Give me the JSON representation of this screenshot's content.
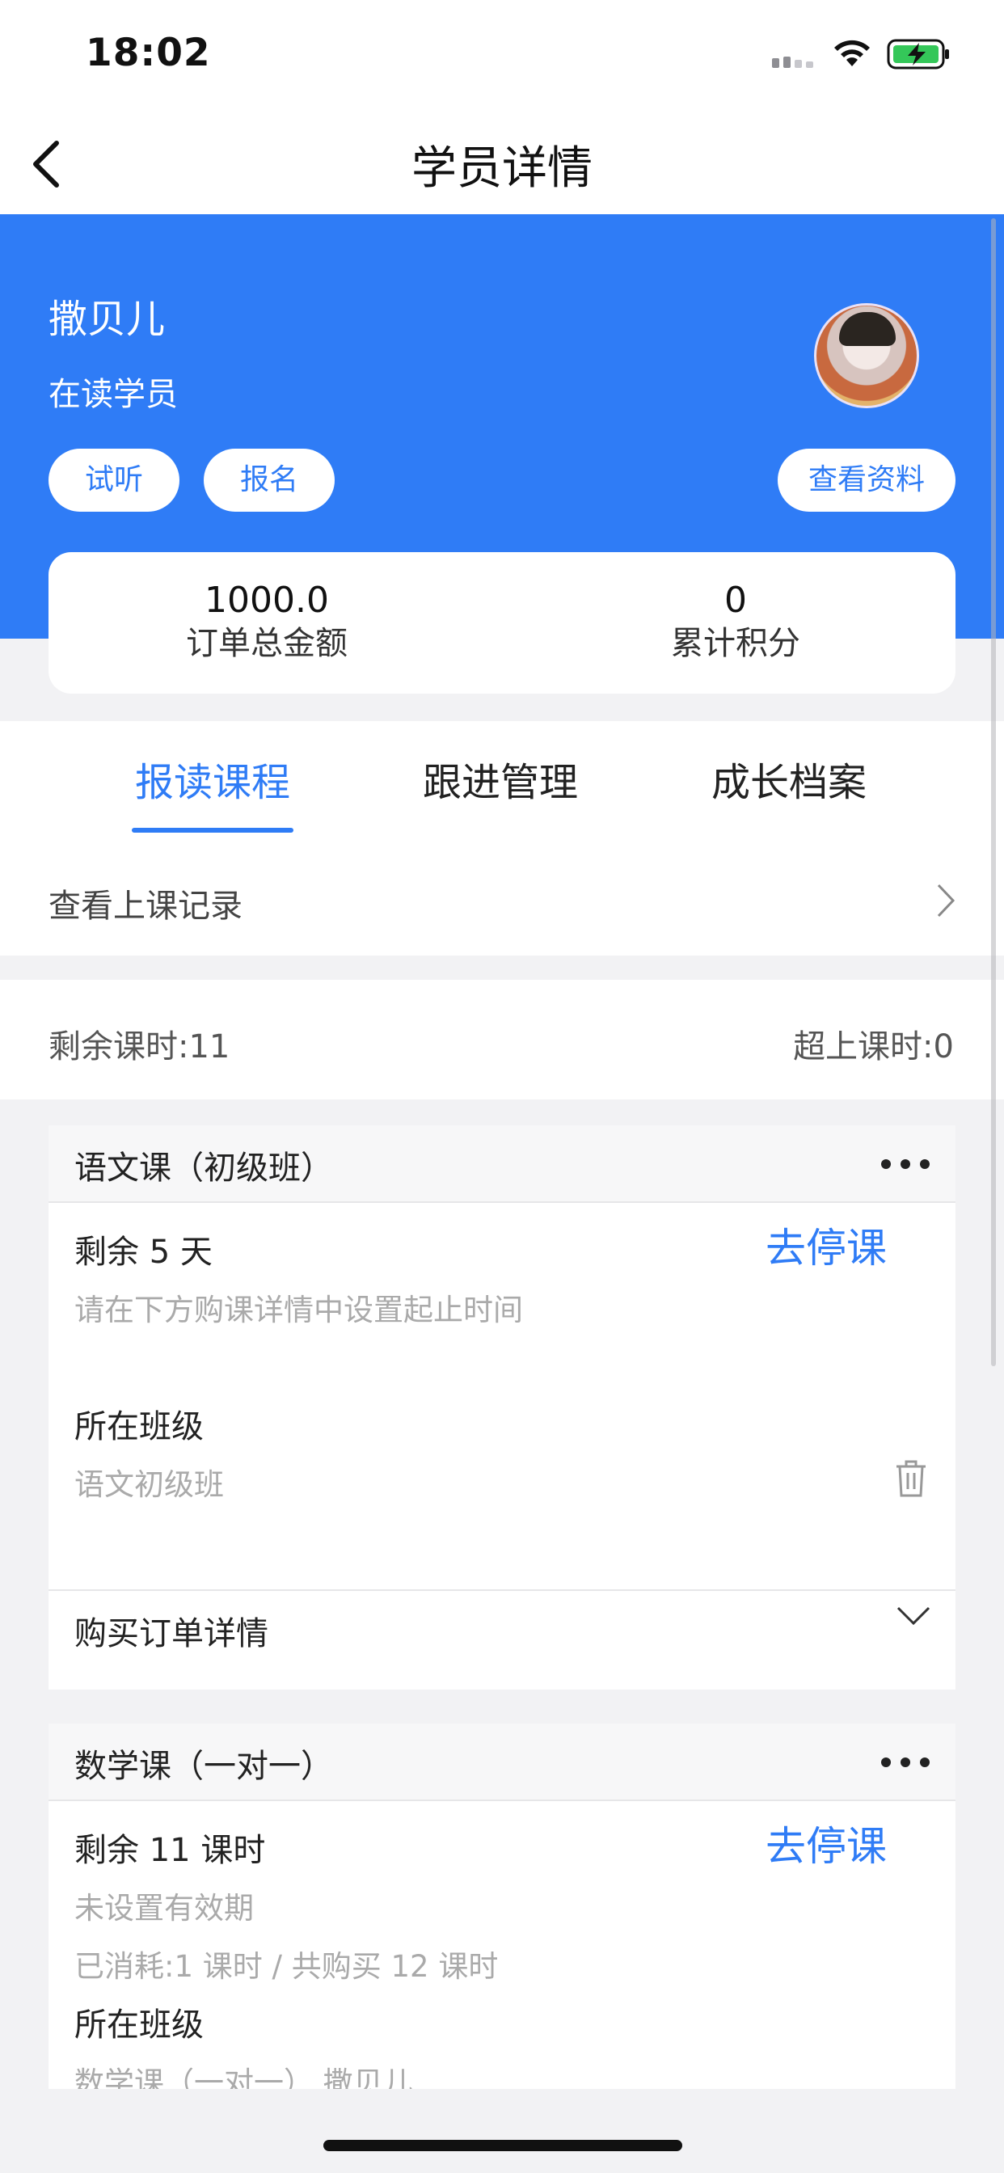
{
  "status_bar": {
    "time": "18:02"
  },
  "nav": {
    "title": "学员详情"
  },
  "student": {
    "name": "撒贝儿",
    "status": "在读学员",
    "buttons": {
      "trial": "试听",
      "enroll": "报名",
      "profile": "查看资料"
    }
  },
  "stats": [
    {
      "value": "1000.0",
      "label": "订单总金额"
    },
    {
      "value": "0",
      "label": "累计积分"
    }
  ],
  "tabs": [
    {
      "label": "报读课程",
      "active": true
    },
    {
      "label": "跟进管理",
      "active": false
    },
    {
      "label": "成长档案",
      "active": false
    }
  ],
  "records_link": "查看上课记录",
  "hours": {
    "remaining": "剩余课时:11",
    "over": "超上课时:0"
  },
  "courses": [
    {
      "title": "语文课（初级班）",
      "remain": "剩余 5 天",
      "stop": "去停课",
      "hint": "请在下方购课详情中设置起止时间",
      "class_label": "所在班级",
      "class_value": "语文初级班",
      "order_label": "购买订单详情"
    },
    {
      "title": "数学课（一对一）",
      "remain": "剩余 11 课时",
      "stop": "去停课",
      "hint": "未设置有效期",
      "consumed": "已消耗:1 课时 / 共购买 12 课时",
      "class_label": "所在班级",
      "class_value": "数学课（一对一） 撒贝儿"
    }
  ],
  "colors": {
    "primary": "#2f7cf6",
    "background": "#f2f2f4"
  }
}
